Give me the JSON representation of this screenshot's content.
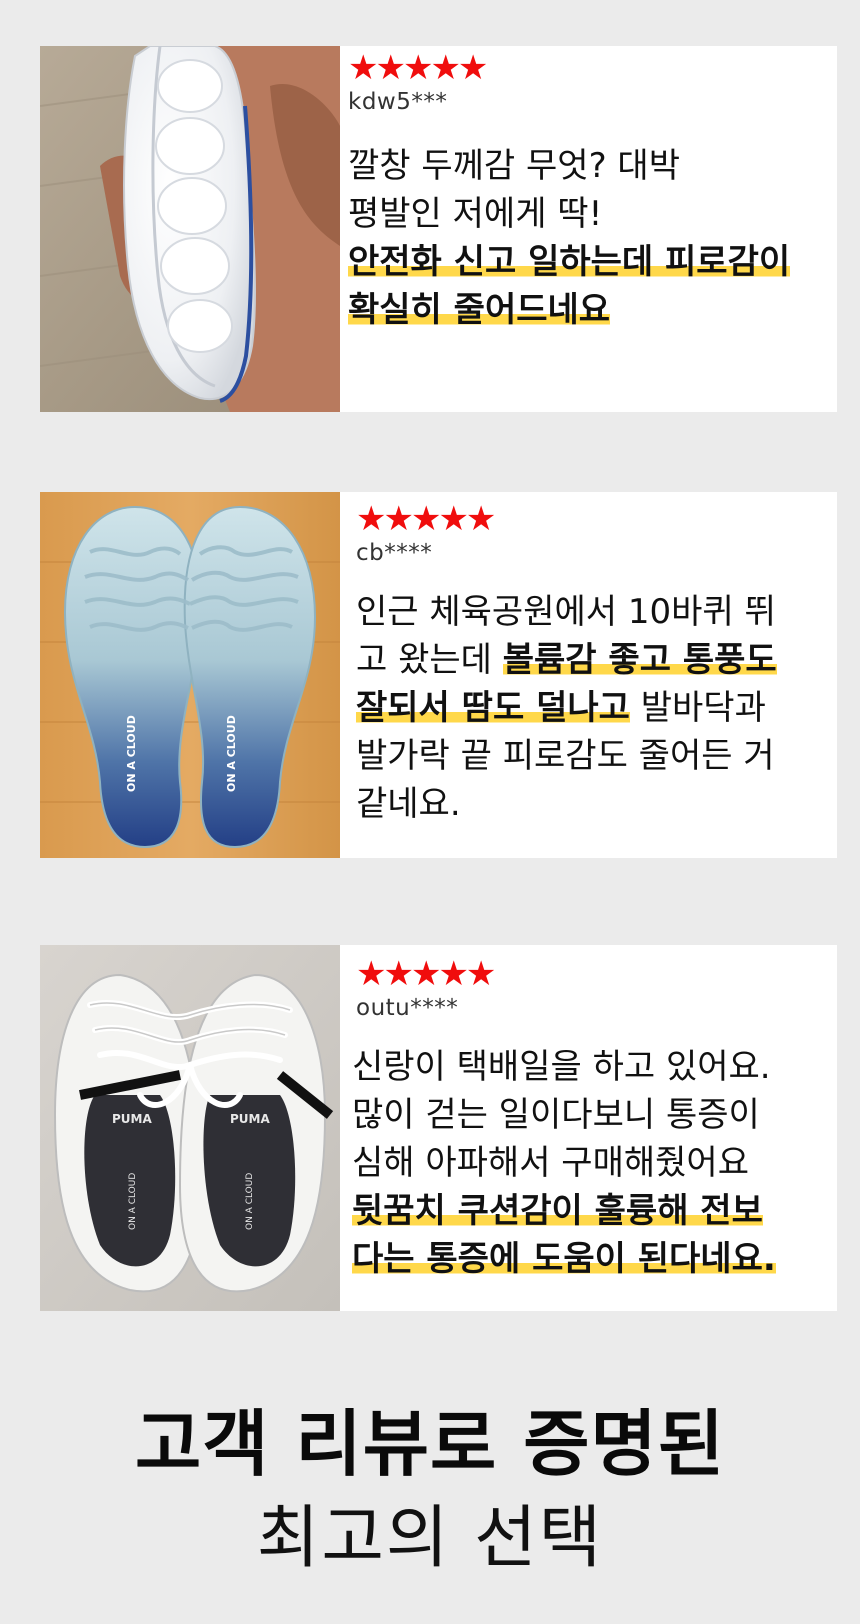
{
  "reviews": [
    {
      "stars": "★★★★★",
      "user": "kdw5***",
      "lines": [
        [
          {
            "t": "깔창 두께감 무엇? 대박",
            "b": false
          }
        ],
        [
          {
            "t": "평발인 저에게 딱!",
            "b": false
          }
        ],
        [
          {
            "t": "안전화 신고 일하는데 피로감이",
            "b": true
          }
        ],
        [
          {
            "t": "확실히 줄어드네요",
            "b": true
          }
        ]
      ]
    },
    {
      "stars": "★★★★★",
      "user": "cb****",
      "lines": [
        [
          {
            "t": "인근 체육공원에서 10바퀴 뛰",
            "b": false
          }
        ],
        [
          {
            "t": "고 왔는데 ",
            "b": false
          },
          {
            "t": "볼륨감 좋고 통풍도",
            "b": true
          }
        ],
        [
          {
            "t": "잘되서 땀도 덜나고",
            "b": true
          },
          {
            "t": " 발바닥과",
            "b": false
          }
        ],
        [
          {
            "t": "발가락 끝 피로감도 줄어든 거",
            "b": false
          }
        ],
        [
          {
            "t": "같네요.",
            "b": false
          }
        ]
      ]
    },
    {
      "stars": "★★★★★",
      "user": "outu****",
      "lines": [
        [
          {
            "t": "신랑이 택배일을 하고 있어요.",
            "b": false
          }
        ],
        [
          {
            "t": "많이 걷는 일이다보니 통증이",
            "b": false
          }
        ],
        [
          {
            "t": "심해 아파해서 구매해줬어요",
            "b": false
          }
        ],
        [
          {
            "t": "뒷꿈치 쿠션감이 훌륭해 전보",
            "b": true
          }
        ],
        [
          {
            "t": "다는 통증에 도움이 된다네요.",
            "b": true
          }
        ]
      ]
    }
  ],
  "brand_text": "ON A CLOUD",
  "shoe_logo": "PUMA",
  "headline": "고객 리뷰로 증명된",
  "subheadline": "최고의 선택",
  "colors": {
    "star": "#f00d0d",
    "highlight": "#ffd84a",
    "background": "#ebebeb"
  }
}
